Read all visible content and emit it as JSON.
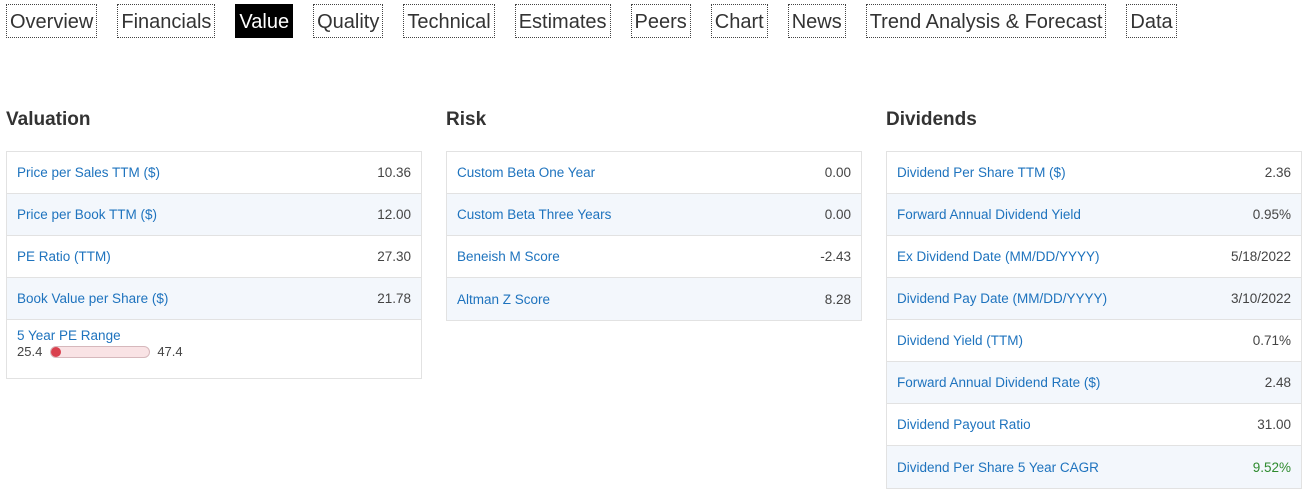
{
  "tabs": [
    {
      "label": "Overview",
      "active": false
    },
    {
      "label": "Financials",
      "active": false
    },
    {
      "label": "Value",
      "active": true
    },
    {
      "label": "Quality",
      "active": false
    },
    {
      "label": "Technical",
      "active": false
    },
    {
      "label": "Estimates",
      "active": false
    },
    {
      "label": "Peers",
      "active": false
    },
    {
      "label": "Chart",
      "active": false
    },
    {
      "label": "News",
      "active": false
    },
    {
      "label": "Trend Analysis & Forecast",
      "active": false
    },
    {
      "label": "Data",
      "active": false
    }
  ],
  "valuation": {
    "title": "Valuation",
    "rows": [
      {
        "label": "Price per Sales TTM ($)",
        "value": "10.36"
      },
      {
        "label": "Price per Book TTM ($)",
        "value": "12.00"
      },
      {
        "label": "PE Ratio (TTM)",
        "value": "27.30"
      },
      {
        "label": "Book Value per Share ($)",
        "value": "21.78"
      }
    ],
    "pe_range": {
      "label": "5 Year PE Range",
      "min": "25.4",
      "max": "47.4",
      "current_fraction": 0.08
    }
  },
  "risk": {
    "title": "Risk",
    "rows": [
      {
        "label": "Custom Beta One Year",
        "value": "0.00"
      },
      {
        "label": "Custom Beta Three Years",
        "value": "0.00"
      },
      {
        "label": "Beneish M Score",
        "value": "-2.43"
      },
      {
        "label": "Altman Z Score",
        "value": "8.28"
      }
    ]
  },
  "dividends": {
    "title": "Dividends",
    "rows": [
      {
        "label": "Dividend Per Share TTM ($)",
        "value": "2.36"
      },
      {
        "label": "Forward Annual Dividend Yield",
        "value": "0.95%"
      },
      {
        "label": "Ex Dividend Date (MM/DD/YYYY)",
        "value": "5/18/2022"
      },
      {
        "label": "Dividend Pay Date (MM/DD/YYYY)",
        "value": "3/10/2022"
      },
      {
        "label": "Dividend Yield (TTM)",
        "value": "0.71%"
      },
      {
        "label": "Forward Annual Dividend Rate ($)",
        "value": "2.48"
      },
      {
        "label": "Dividend Payout Ratio",
        "value": "31.00"
      },
      {
        "label": "Dividend Per Share 5 Year CAGR",
        "value": "9.52%",
        "positive": true
      }
    ]
  },
  "colors": {
    "link": "#1e73be",
    "active_tab_bg": "#000000",
    "alt_row_bg": "#f3f7fc",
    "positive": "#2e8b2e",
    "range_fill": "#d9404e"
  }
}
